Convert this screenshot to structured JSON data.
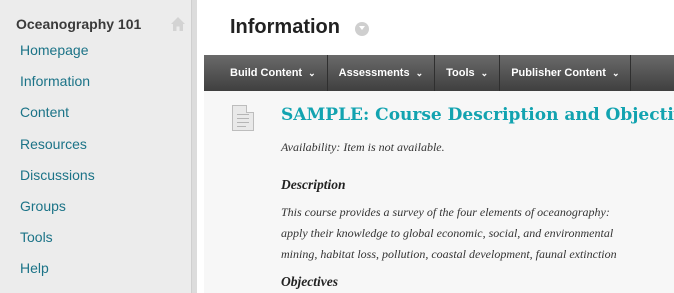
{
  "sidebar": {
    "course_title": "Oceanography 101",
    "home_icon": "home-icon",
    "items": [
      {
        "label": "Homepage"
      },
      {
        "label": "Information"
      },
      {
        "label": "Content"
      },
      {
        "label": "Resources"
      },
      {
        "label": "Discussions"
      },
      {
        "label": "Groups"
      },
      {
        "label": "Tools"
      },
      {
        "label": "Help"
      }
    ]
  },
  "header": {
    "title": "Information"
  },
  "action_bar": {
    "items": [
      {
        "label": "Build Content"
      },
      {
        "label": "Assessments"
      },
      {
        "label": "Tools"
      },
      {
        "label": "Publisher Content"
      }
    ],
    "chevron": "⌄"
  },
  "content": {
    "item_title": "SAMPLE: Course Description and Objectives",
    "availability": "Availability:  Item is not available.",
    "description_heading": "Description",
    "description_lines": [
      "This course provides a survey of the four elements of oceanography:",
      "apply their knowledge to global economic, social, and environmental",
      "mining, habitat loss, pollution, coastal development, faunal extinction"
    ],
    "objectives_heading": "Objectives"
  },
  "colors": {
    "link": "#1b7387",
    "item_title": "#12a3b0",
    "action_bar": "#4d4d4d"
  }
}
